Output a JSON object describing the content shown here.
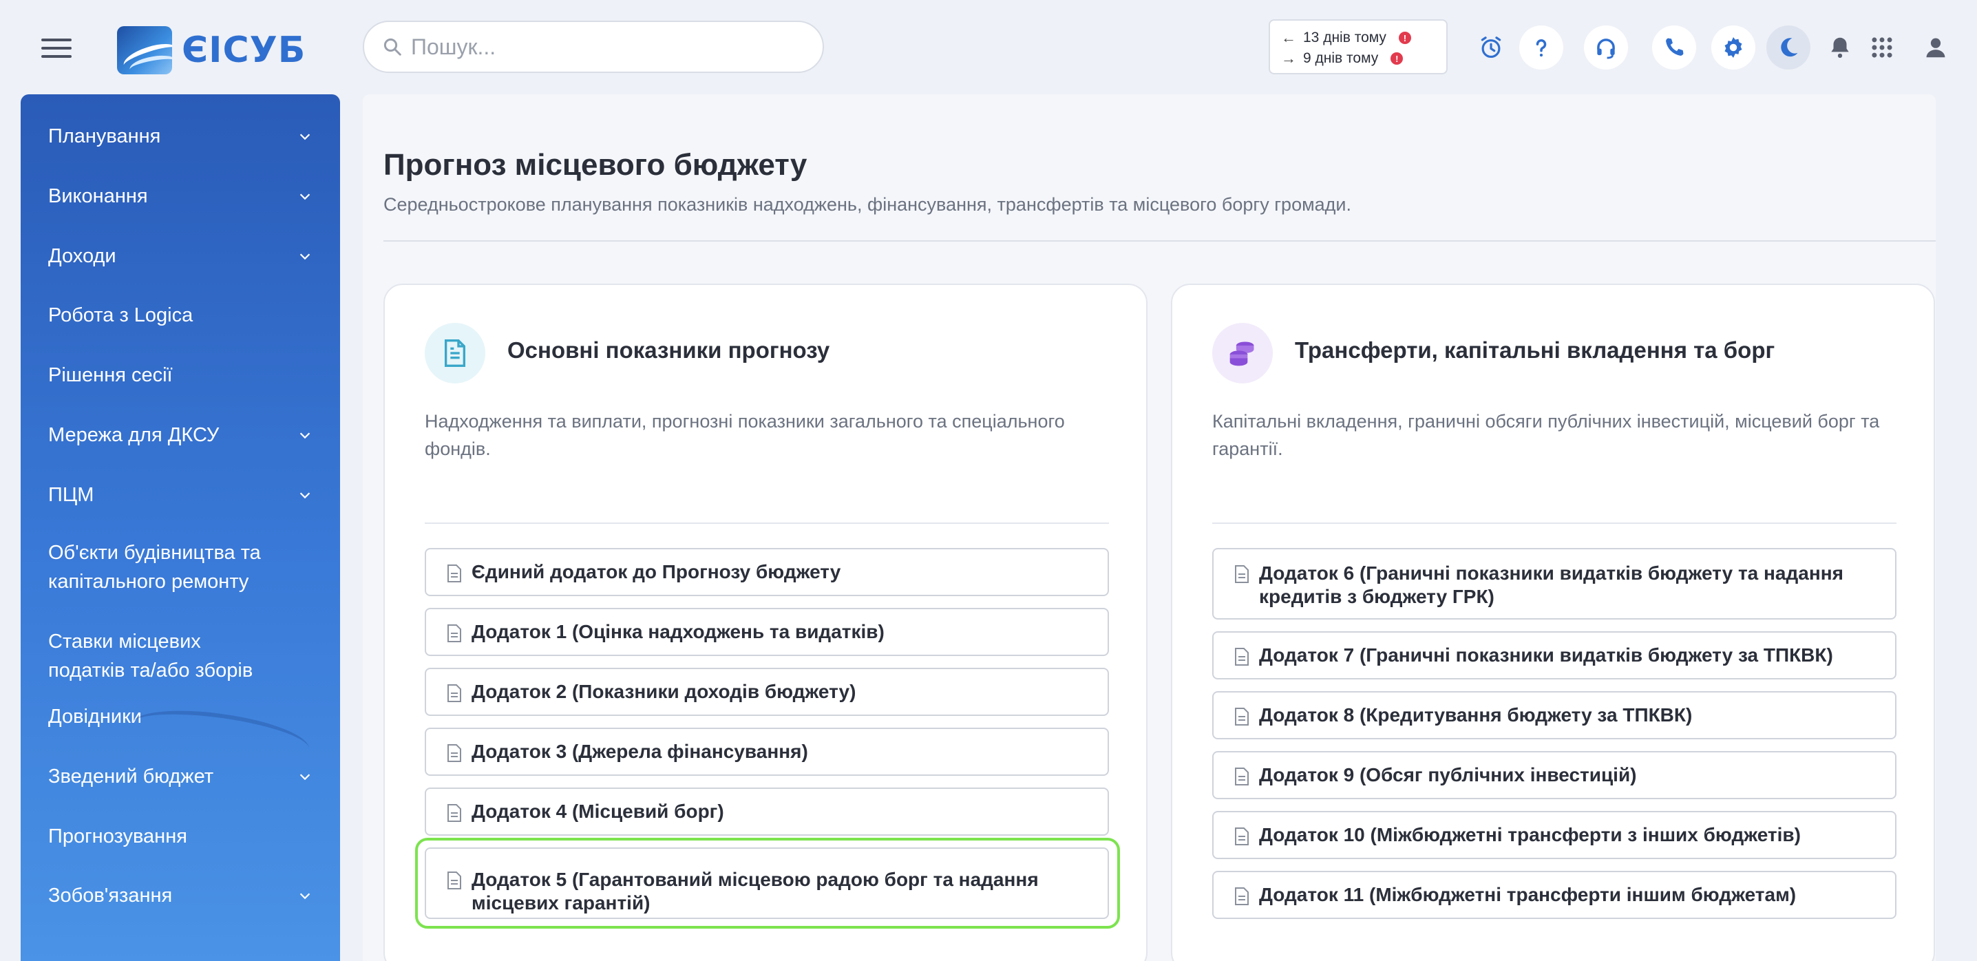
{
  "header": {
    "logo_text": "ЄІСУБ",
    "search_placeholder": "Пошук...",
    "history": {
      "back_label": "13 днів тому",
      "forward_label": "9 днів тому",
      "alert_glyph": "!"
    },
    "icons": [
      "menu-icon",
      "alarm-clock-icon",
      "help-icon",
      "headset-icon",
      "phone-icon",
      "gear-icon",
      "moon-icon",
      "bell-icon",
      "apps-grid-icon",
      "user-icon"
    ]
  },
  "sidebar": {
    "items": [
      {
        "label": "Планування",
        "has_submenu": true
      },
      {
        "label": "Виконання",
        "has_submenu": true
      },
      {
        "label": "Доходи",
        "has_submenu": true
      },
      {
        "label": "Робота з Logica",
        "has_submenu": false
      },
      {
        "label": "Рішення сесії",
        "has_submenu": false
      },
      {
        "label": "Мережа для ДКСУ",
        "has_submenu": true
      },
      {
        "label": "ПЦМ",
        "has_submenu": true
      },
      {
        "label": "Об'єкти будівництва та капітального ремонту",
        "has_submenu": false
      },
      {
        "label": "Ставки місцевих податків та/або зборів",
        "has_submenu": false
      },
      {
        "label": "Довідники",
        "has_submenu": false
      },
      {
        "label": "Зведений бюджет",
        "has_submenu": true
      },
      {
        "label": "Прогнозування",
        "has_submenu": false
      },
      {
        "label": "Зобов'язання",
        "has_submenu": true
      }
    ]
  },
  "page": {
    "title": "Прогноз місцевого бюджету",
    "subtitle": "Середньострокове планування показників надходжень, фінансування, трансфертів та місцевого боргу громади."
  },
  "cards": [
    {
      "title": "Основні показники прогнозу",
      "icon": "document-icon",
      "icon_color": "#3aa7c9",
      "icon_bg": "#e6f5f9",
      "description": "Надходження та виплати, прогнозні показники загального та спеціального фондів.",
      "items": [
        "Єдиний додаток до Прогнозу бюджету",
        "Додаток 1 (Оцінка надходжень та видатків)",
        "Додаток 2 (Показники доходів бюджету)",
        "Додаток 3 (Джерела фінансування)",
        "Додаток 4 (Місцевий борг)",
        "Додаток 5 (Гарантований місцевою радою борг та надання місцевих гарантій)"
      ]
    },
    {
      "title": "Трансферти, капітальні вкладення та борг",
      "icon": "coins-icon",
      "icon_color": "#8a4fd8",
      "icon_bg": "#f2ebfb",
      "description": "Капітальні вкладення, граничні обсяги публічних інвестицій, місцевий борг та гарантії.",
      "items": [
        "Додаток 6 (Граничні показники видатків бюджету та надання кредитів з бюджету ГРК)",
        "Додаток 7 (Граничні показники видатків бюджету за ТПКВК)",
        "Додаток 8 (Кредитування бюджету за ТПКВК)",
        "Додаток 9 (Обсяг публічних інвестицій)",
        "Додаток 10 (Міжбюджетні трансферти з інших бюджетів)",
        "Додаток 11 (Міжбюджетні трансферти іншим бюджетам)"
      ]
    }
  ],
  "colors": {
    "accent": "#2f6fd0",
    "sidebar_top": "#2a5bb8",
    "sidebar_bottom": "#4a93e6",
    "highlight": "#7de34f",
    "alert": "#e23b4e"
  }
}
